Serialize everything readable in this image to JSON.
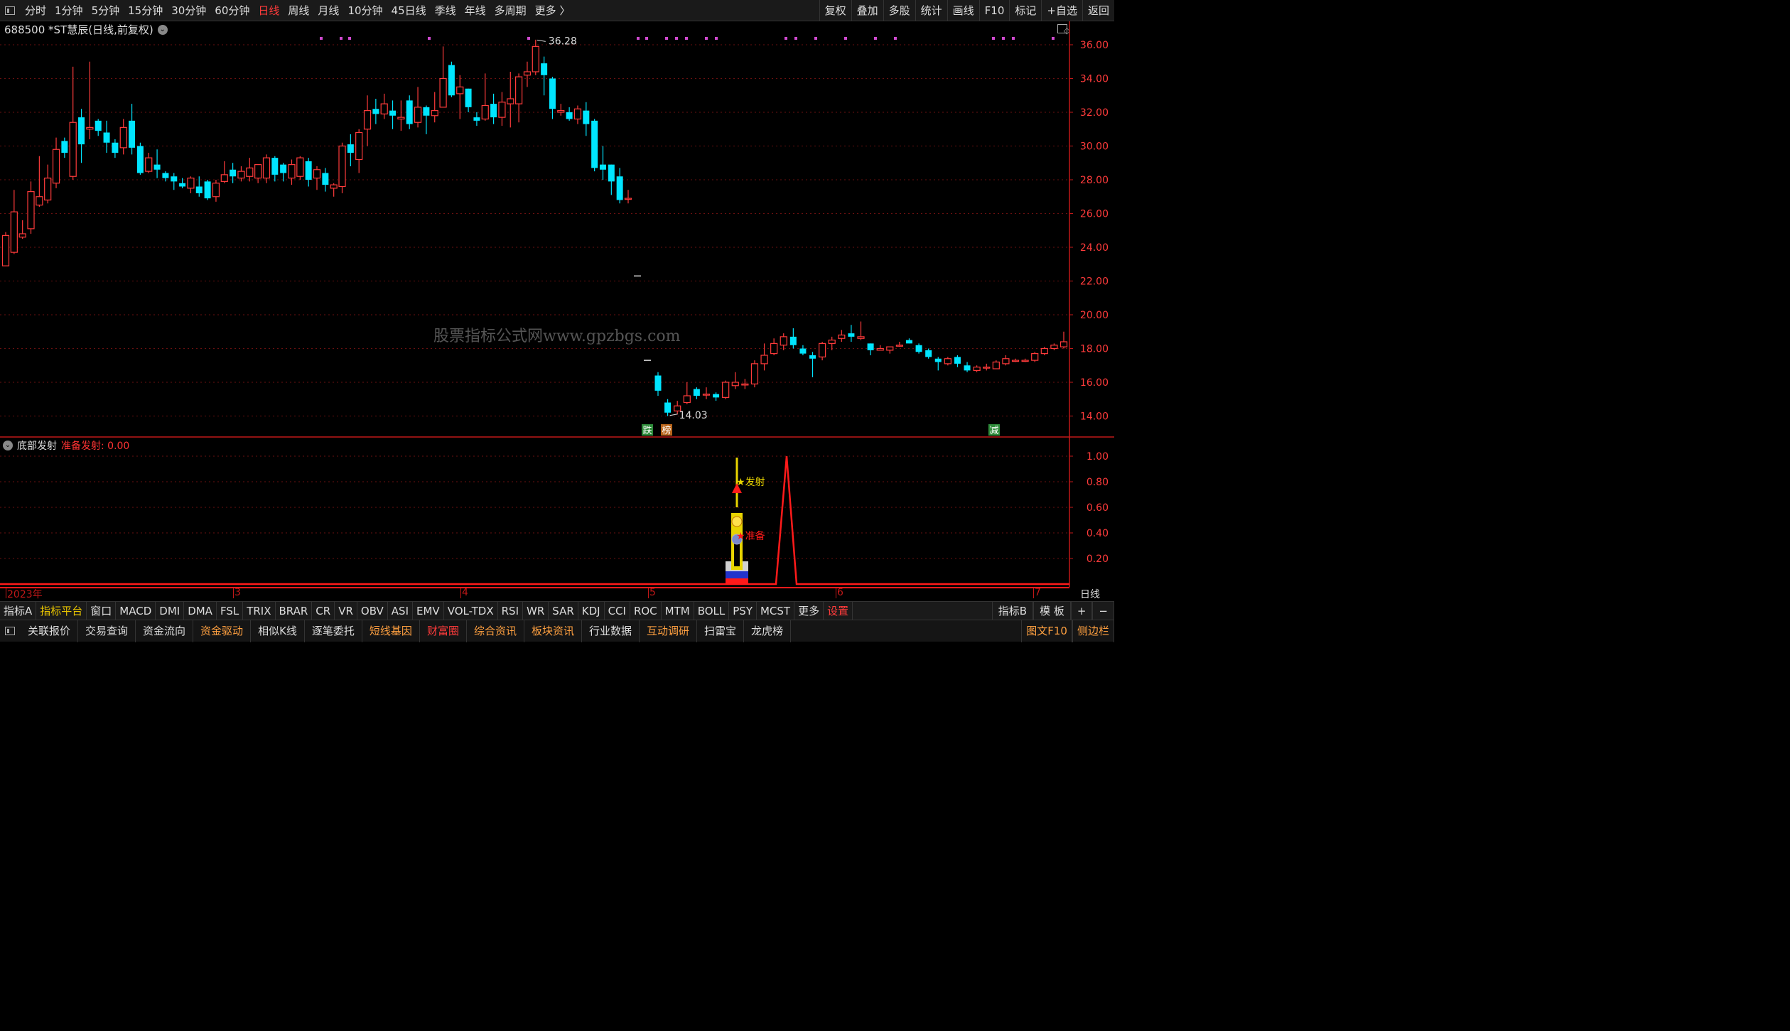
{
  "topbar": {
    "periods": [
      {
        "label": "分时",
        "active": false
      },
      {
        "label": "1分钟",
        "active": false
      },
      {
        "label": "5分钟",
        "active": false
      },
      {
        "label": "15分钟",
        "active": false
      },
      {
        "label": "30分钟",
        "active": false
      },
      {
        "label": "60分钟",
        "active": false
      },
      {
        "label": "日线",
        "active": true
      },
      {
        "label": "周线",
        "active": false
      },
      {
        "label": "月线",
        "active": false
      },
      {
        "label": "10分钟",
        "active": false
      },
      {
        "label": "45日线",
        "active": false
      },
      {
        "label": "季线",
        "active": false
      },
      {
        "label": "年线",
        "active": false
      },
      {
        "label": "多周期",
        "active": false
      },
      {
        "label": "更多 〉",
        "active": false
      }
    ],
    "right_buttons": [
      "复权",
      "叠加",
      "多股",
      "统计",
      "画线",
      "F10",
      "标记",
      "+自选",
      "返回"
    ]
  },
  "chart": {
    "title": "688500 *ST慧辰(日线,前复权)",
    "watermark": "股票指标公式网www.gpzbgs.com",
    "y_axis_labels": [
      "36.00",
      "34.00",
      "32.00",
      "30.00",
      "28.00",
      "26.00",
      "24.00",
      "22.00",
      "20.00",
      "18.00",
      "16.00",
      "14.00"
    ],
    "high_label": "36.28",
    "low_label": "14.03",
    "markers": [
      {
        "text": "跌",
        "color": "#2e8b3a"
      },
      {
        "text": "榜",
        "color": "#b8651b"
      },
      {
        "text": "减",
        "color": "#2e8b3a"
      }
    ],
    "up_color": "#ff3b3b",
    "down_color": "#00e5ff"
  },
  "indicator": {
    "name": "底部发射",
    "value_label": "准备发射: 0.00",
    "y_axis_labels": [
      "1.00",
      "0.80",
      "0.60",
      "0.40",
      "0.20"
    ],
    "label_launch": "发射",
    "label_prepare": "准备",
    "dates": [
      {
        "text": "2023年"
      },
      {
        "text": "3"
      },
      {
        "text": "4"
      },
      {
        "text": "5"
      },
      {
        "text": "6"
      },
      {
        "text": "7"
      }
    ],
    "period_label": "日线"
  },
  "tabsbar": {
    "tabs": [
      {
        "label": "指标A",
        "style": ""
      },
      {
        "label": "指标平台",
        "style": "yellow"
      },
      {
        "label": "窗口",
        "style": ""
      },
      {
        "label": "MACD",
        "style": ""
      },
      {
        "label": "DMI",
        "style": ""
      },
      {
        "label": "DMA",
        "style": ""
      },
      {
        "label": "FSL",
        "style": ""
      },
      {
        "label": "TRIX",
        "style": ""
      },
      {
        "label": "BRAR",
        "style": ""
      },
      {
        "label": "CR",
        "style": ""
      },
      {
        "label": "VR",
        "style": ""
      },
      {
        "label": "OBV",
        "style": ""
      },
      {
        "label": "ASI",
        "style": ""
      },
      {
        "label": "EMV",
        "style": ""
      },
      {
        "label": "VOL-TDX",
        "style": ""
      },
      {
        "label": "RSI",
        "style": ""
      },
      {
        "label": "WR",
        "style": ""
      },
      {
        "label": "SAR",
        "style": ""
      },
      {
        "label": "KDJ",
        "style": ""
      },
      {
        "label": "CCI",
        "style": ""
      },
      {
        "label": "ROC",
        "style": ""
      },
      {
        "label": "MTM",
        "style": ""
      },
      {
        "label": "BOLL",
        "style": ""
      },
      {
        "label": "PSY",
        "style": ""
      },
      {
        "label": "MCST",
        "style": ""
      },
      {
        "label": "更多",
        "style": ""
      },
      {
        "label": "设置",
        "style": "red"
      }
    ],
    "right": [
      "指标B",
      "模 板",
      "+",
      "−"
    ]
  },
  "bottombar": {
    "buttons": [
      {
        "label": "关联报价",
        "color": "white"
      },
      {
        "label": "交易查询",
        "color": "white"
      },
      {
        "label": "资金流向",
        "color": "white"
      },
      {
        "label": "资金驱动",
        "color": "orange"
      },
      {
        "label": "相似K线",
        "color": "white"
      },
      {
        "label": "逐笔委托",
        "color": "white"
      },
      {
        "label": "短线基因",
        "color": "orange"
      },
      {
        "label": "财富圈",
        "color": "red"
      },
      {
        "label": "综合资讯",
        "color": "orange"
      },
      {
        "label": "板块资讯",
        "color": "orange"
      },
      {
        "label": "行业数据",
        "color": "white"
      },
      {
        "label": "互动调研",
        "color": "orange"
      },
      {
        "label": "扫雷宝",
        "color": "white"
      },
      {
        "label": "龙虎榜",
        "color": "white"
      }
    ],
    "right": [
      {
        "label": "图文F10",
        "color": "orange"
      },
      {
        "label": "侧边栏",
        "color": "orange"
      }
    ]
  }
}
